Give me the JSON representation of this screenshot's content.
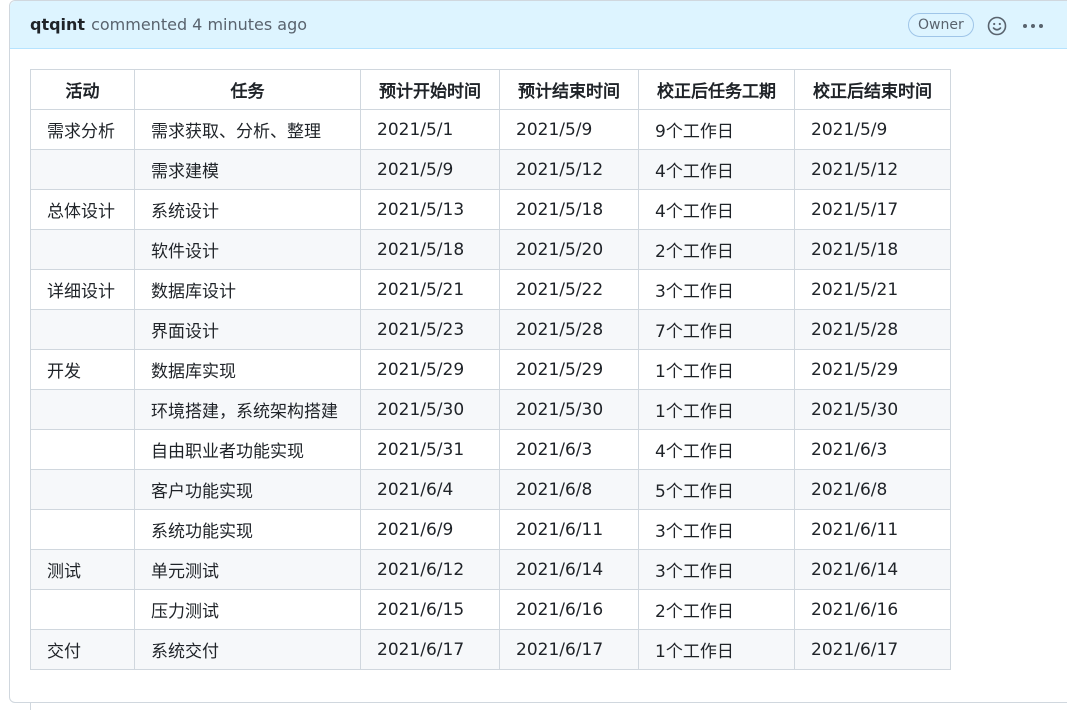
{
  "comment": {
    "author": "qtqint",
    "action": "commented 4 minutes ago",
    "badge": "Owner",
    "icons": [
      "smiley-icon",
      "kebab-icon"
    ],
    "colors": {
      "header_bg": "#ddf4ff",
      "border": "#d0d7de"
    }
  },
  "table": {
    "headers": [
      "活动",
      "任务",
      "预计开始时间",
      "预计结束时间",
      "校正后任务工期",
      "校正后结束时间"
    ],
    "rows": [
      [
        "需求分析",
        "需求获取、分析、整理",
        "2021/5/1",
        "2021/5/9",
        "9个工作日",
        "2021/5/9"
      ],
      [
        "",
        "需求建模",
        "2021/5/9",
        "2021/5/12",
        "4个工作日",
        "2021/5/12"
      ],
      [
        "总体设计",
        "系统设计",
        "2021/5/13",
        "2021/5/18",
        "4个工作日",
        "2021/5/17"
      ],
      [
        "",
        "软件设计",
        "2021/5/18",
        "2021/5/20",
        "2个工作日",
        "2021/5/18"
      ],
      [
        "详细设计",
        "数据库设计",
        "2021/5/21",
        "2021/5/22",
        "3个工作日",
        "2021/5/21"
      ],
      [
        "",
        "界面设计",
        "2021/5/23",
        "2021/5/28",
        "7个工作日",
        "2021/5/28"
      ],
      [
        "开发",
        "数据库实现",
        "2021/5/29",
        "2021/5/29",
        "1个工作日",
        "2021/5/29"
      ],
      [
        "",
        "环境搭建，系统架构搭建",
        "2021/5/30",
        "2021/5/30",
        "1个工作日",
        "2021/5/30"
      ],
      [
        "",
        "自由职业者功能实现",
        "2021/5/31",
        "2021/6/3",
        "4个工作日",
        "2021/6/3"
      ],
      [
        "",
        "客户功能实现",
        "2021/6/4",
        "2021/6/8",
        "5个工作日",
        "2021/6/8"
      ],
      [
        "",
        "系统功能实现",
        "2021/6/9",
        "2021/6/11",
        "3个工作日",
        "2021/6/11"
      ],
      [
        "测试",
        "单元测试",
        "2021/6/12",
        "2021/6/14",
        "3个工作日",
        "2021/6/14"
      ],
      [
        "",
        "压力测试",
        "2021/6/15",
        "2021/6/16",
        "2个工作日",
        "2021/6/16"
      ],
      [
        "交付",
        "系统交付",
        "2021/6/17",
        "2021/6/17",
        "1个工作日",
        "2021/6/17"
      ]
    ]
  }
}
